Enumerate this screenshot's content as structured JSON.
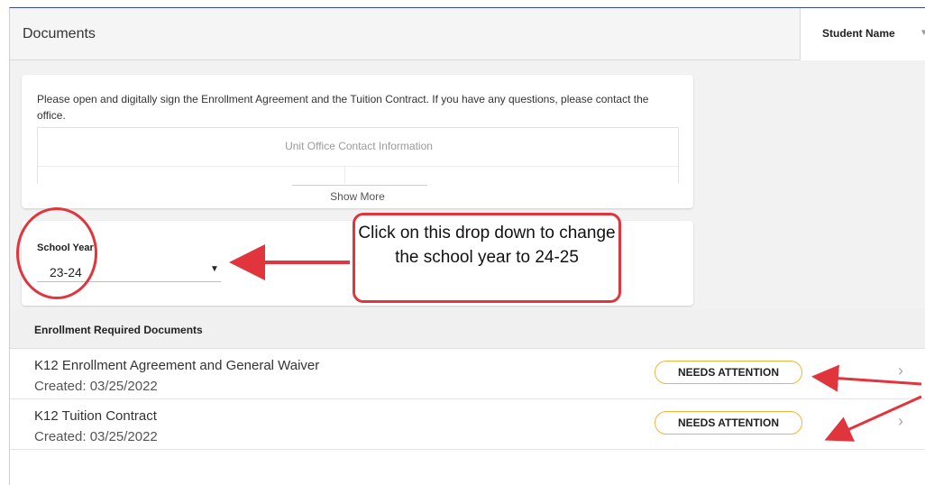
{
  "header": {
    "title": "Documents",
    "student_select_label": "Student Name"
  },
  "info_card": {
    "message": "Please open and digitally sign the Enrollment Agreement and the Tuition Contract. If you have any questions, please contact the office.",
    "contact_title": "Unit Office Contact Information",
    "show_more": "Show More"
  },
  "school_year": {
    "label": "School Year",
    "selected": "23-24"
  },
  "callout": {
    "text": "Click on this drop down to change the school year to 24-25"
  },
  "documents": {
    "header": "Enrollment Required Documents",
    "items": [
      {
        "title": "K12 Enrollment Agreement and General Waiver",
        "created": "Created: 03/25/2022",
        "status": "NEEDS ATTENTION"
      },
      {
        "title": "K12 Tuition Contract",
        "created": "Created: 03/25/2022",
        "status": "NEEDS ATTENTION"
      }
    ]
  },
  "colors": {
    "annotation_red": "#e0353c",
    "badge_border": "#f0b43a",
    "header_accent": "#3b4a8c"
  },
  "icons": [
    "chevron-down-icon",
    "chevron-right-icon",
    "arrow-left-icon"
  ]
}
